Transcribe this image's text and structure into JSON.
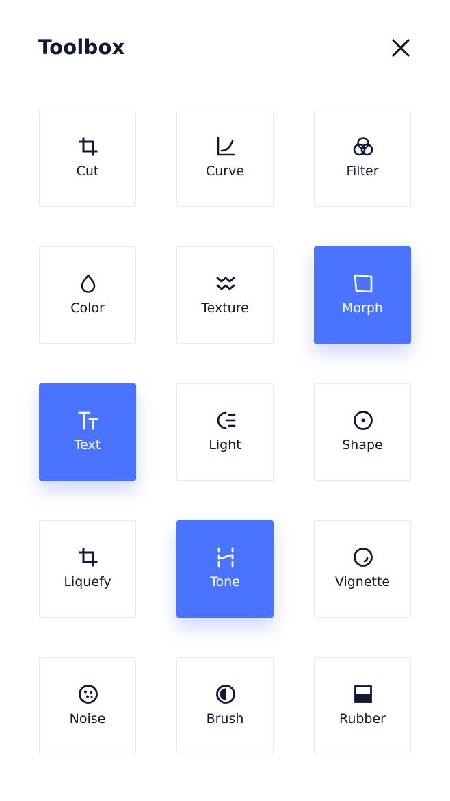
{
  "header": {
    "title": "Toolbox"
  },
  "colors": {
    "accent": "#4a73ff",
    "text": "#111834",
    "tile_border": "#e7e9ee"
  },
  "tools": [
    {
      "label": "Cut",
      "icon": "crop-icon",
      "active": false
    },
    {
      "label": "Curve",
      "icon": "curve-icon",
      "active": true
    },
    {
      "label": "Filter",
      "icon": "filter-circles-icon",
      "active": false
    },
    {
      "label": "Color",
      "icon": "droplet-icon",
      "active": false
    },
    {
      "label": "Texture",
      "icon": "zigzag-icon",
      "active": false
    },
    {
      "label": "Morph",
      "icon": "skewed-square-icon",
      "active": true
    },
    {
      "label": "Text",
      "icon": "text-size-icon",
      "active": true
    },
    {
      "label": "Light",
      "icon": "light-icon",
      "active": false
    },
    {
      "label": "Shape",
      "icon": "target-circle-icon",
      "active": false
    },
    {
      "label": "Liquefy",
      "icon": "crop-icon",
      "active": false
    },
    {
      "label": "Tone",
      "icon": "tone-icon",
      "active": true
    },
    {
      "label": "Vignette",
      "icon": "vignette-icon",
      "active": false
    },
    {
      "label": "Noise",
      "icon": "noise-icon",
      "active": false
    },
    {
      "label": "Brush",
      "icon": "half-circle-icon",
      "active": false
    },
    {
      "label": "Rubber",
      "icon": "rubber-icon",
      "active": false
    }
  ]
}
